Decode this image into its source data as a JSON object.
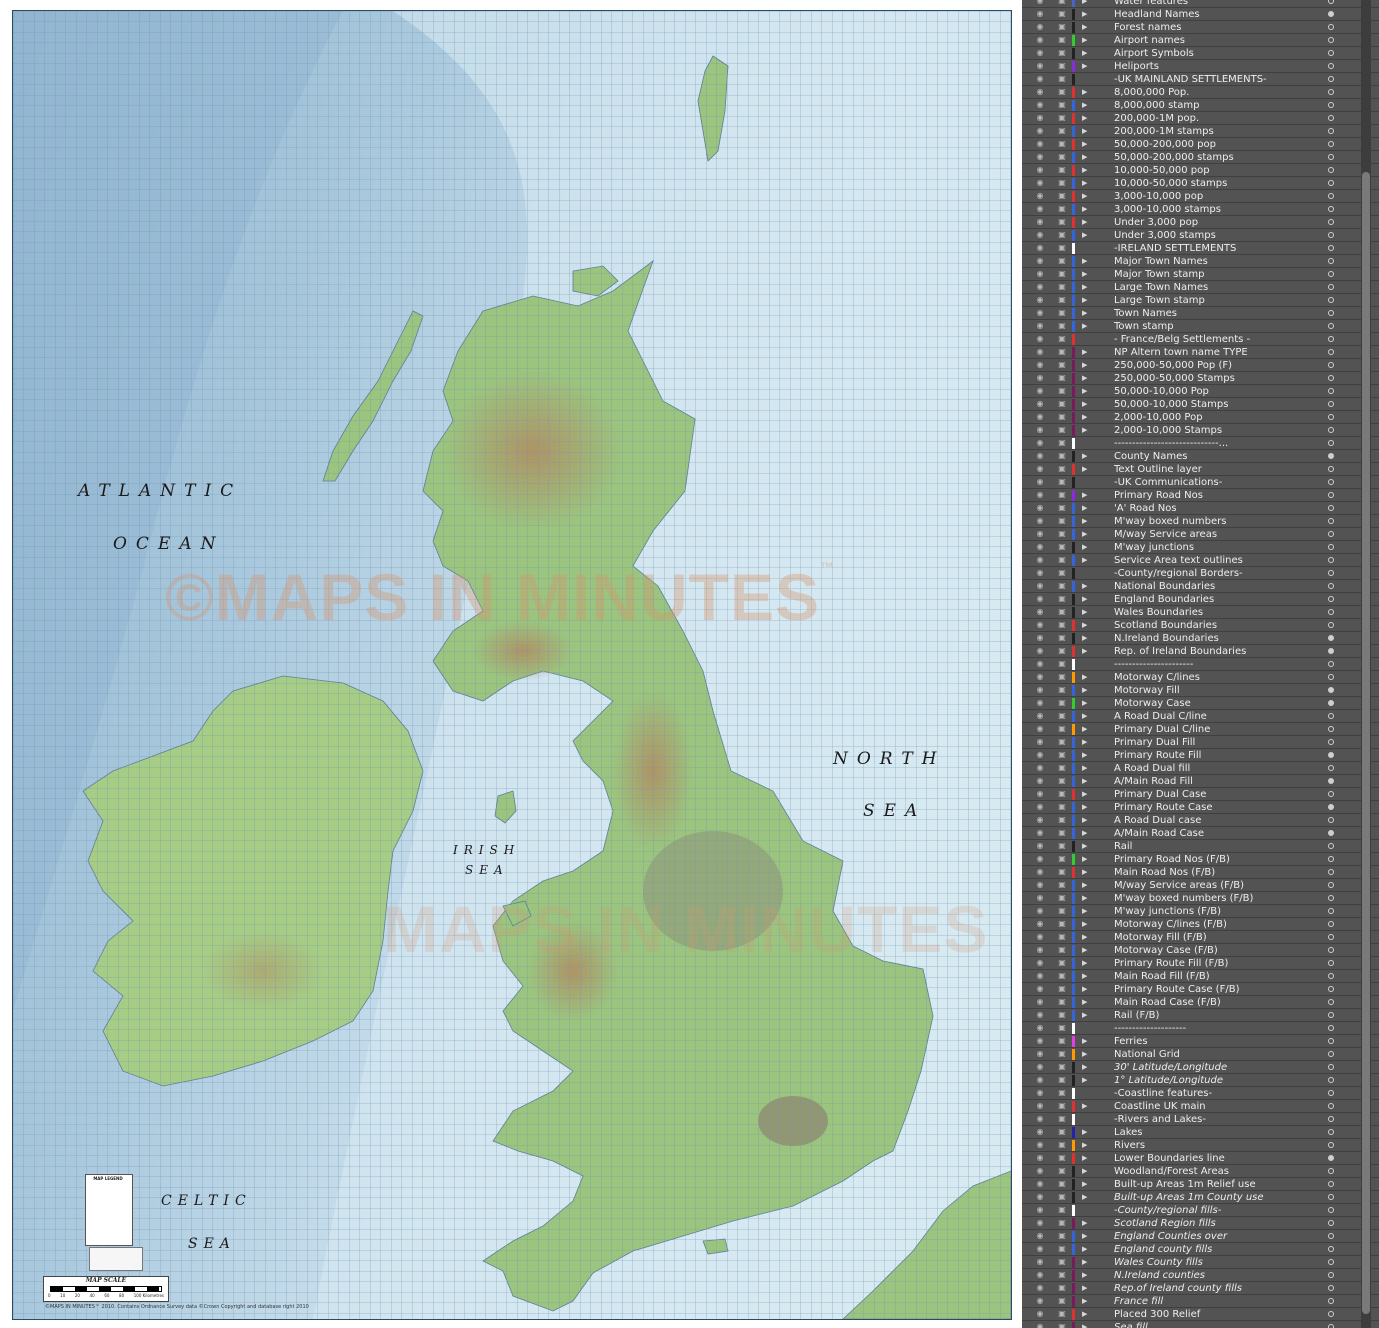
{
  "map": {
    "sea_labels": {
      "atlantic": "ATLANTIC",
      "ocean": "OCEAN",
      "north": "NORTH",
      "sea_north": "SEA",
      "irish": "IRISH",
      "sea_irish": "SEA",
      "celtic": "CELTIC",
      "sea_celtic": "SEA"
    },
    "watermark": "©MAPS IN MINUTES",
    "watermark_tm": "™",
    "watermark_2": "MAPS IN MINUTES",
    "scale_title": "MAP SCALE",
    "scale_ticks": [
      "0",
      "10",
      "20",
      "40",
      "60",
      "80",
      "100 Kilometres"
    ],
    "legend_title": "MAP LEGEND",
    "copyright": "©MAPS IN MINUTES™ 2010. Contains Ordnance Survey data ©Crown Copyright and database right 2010",
    "colors": {
      "sea": "#bcd9ea",
      "land": "#9bc47f",
      "upland": "#b99d74",
      "grid": "#6f93ad"
    }
  },
  "layers": [
    {
      "name": "Water features",
      "color": "#4466cc",
      "expand": true,
      "target": false,
      "italic": false
    },
    {
      "name": "Headland Names",
      "color": "#222222",
      "expand": true,
      "target": true,
      "italic": false
    },
    {
      "name": "Forest names",
      "color": "#222222",
      "expand": true,
      "target": false,
      "italic": false
    },
    {
      "name": "Airport names",
      "color": "#33cc33",
      "expand": true,
      "target": false,
      "italic": false
    },
    {
      "name": "Airport Symbols",
      "color": "#222222",
      "expand": true,
      "target": false,
      "italic": false
    },
    {
      "name": "Heliports",
      "color": "#8a2be2",
      "expand": true,
      "target": false,
      "italic": false
    },
    {
      "name": "-UK MAINLAND SETTLEMENTS-",
      "color": "#222222",
      "expand": false,
      "target": false,
      "italic": false
    },
    {
      "name": "8,000,000 Pop.",
      "color": "#e03030",
      "expand": true,
      "target": false,
      "italic": false
    },
    {
      "name": "8,000,000 stamp",
      "color": "#3366dd",
      "expand": true,
      "target": false,
      "italic": false
    },
    {
      "name": "200,000-1M pop.",
      "color": "#e03030",
      "expand": true,
      "target": false,
      "italic": false
    },
    {
      "name": "200,000-1M stamps",
      "color": "#3366dd",
      "expand": true,
      "target": false,
      "italic": false
    },
    {
      "name": "50,000-200,000 pop",
      "color": "#e03030",
      "expand": true,
      "target": false,
      "italic": false
    },
    {
      "name": "50,000-200,000 stamps",
      "color": "#3366dd",
      "expand": true,
      "target": false,
      "italic": false
    },
    {
      "name": "10,000-50,000 pop",
      "color": "#e03030",
      "expand": true,
      "target": false,
      "italic": false
    },
    {
      "name": "10,000-50,000 stamps",
      "color": "#3366dd",
      "expand": true,
      "target": false,
      "italic": false
    },
    {
      "name": "3,000-10,000 pop",
      "color": "#e03030",
      "expand": true,
      "target": false,
      "italic": false
    },
    {
      "name": "3,000-10,000 stamps",
      "color": "#3366dd",
      "expand": true,
      "target": false,
      "italic": false
    },
    {
      "name": "Under 3,000 pop",
      "color": "#e03030",
      "expand": true,
      "target": false,
      "italic": false
    },
    {
      "name": "Under 3,000 stamps",
      "color": "#3366dd",
      "expand": true,
      "target": false,
      "italic": false
    },
    {
      "name": "-IRELAND SETTLEMENTS",
      "color": "#ffffff",
      "expand": false,
      "target": false,
      "italic": false
    },
    {
      "name": "Major Town Names",
      "color": "#3366dd",
      "expand": true,
      "target": false,
      "italic": false
    },
    {
      "name": "Major Town stamp",
      "color": "#3366dd",
      "expand": true,
      "target": false,
      "italic": false
    },
    {
      "name": "Large Town Names",
      "color": "#3366dd",
      "expand": true,
      "target": false,
      "italic": false
    },
    {
      "name": "Large Town stamp",
      "color": "#3366dd",
      "expand": true,
      "target": false,
      "italic": false
    },
    {
      "name": "Town Names",
      "color": "#3366dd",
      "expand": true,
      "target": false,
      "italic": false
    },
    {
      "name": "Town stamp",
      "color": "#3366dd",
      "expand": true,
      "target": false,
      "italic": false
    },
    {
      "name": "- France/Belg Settlements -",
      "color": "#e03030",
      "expand": false,
      "target": false,
      "italic": false
    },
    {
      "name": "NP Altern town name TYPE",
      "color": "#7a1a5a",
      "expand": true,
      "target": false,
      "italic": false
    },
    {
      "name": "250,000-50,000 Pop (F)",
      "color": "#7a1a5a",
      "expand": true,
      "target": false,
      "italic": false
    },
    {
      "name": "250,000-50,000 Stamps",
      "color": "#7a1a5a",
      "expand": true,
      "target": false,
      "italic": false
    },
    {
      "name": "50,000-10,000 Pop",
      "color": "#7a1a5a",
      "expand": true,
      "target": false,
      "italic": false
    },
    {
      "name": "50,000-10,000 Stamps",
      "color": "#7a1a5a",
      "expand": true,
      "target": false,
      "italic": false
    },
    {
      "name": "2,000-10,000 Pop",
      "color": "#7a1a5a",
      "expand": true,
      "target": false,
      "italic": false
    },
    {
      "name": "2,000-10,000 Stamps",
      "color": "#7a1a5a",
      "expand": true,
      "target": false,
      "italic": false
    },
    {
      "name": "-----------------------------...",
      "color": "#ffffff",
      "expand": false,
      "target": false,
      "italic": false
    },
    {
      "name": "County Names",
      "color": "#222222",
      "expand": true,
      "target": true,
      "italic": false
    },
    {
      "name": "Text Outline layer",
      "color": "#e03030",
      "expand": true,
      "target": false,
      "italic": false
    },
    {
      "name": "-UK Communications-",
      "color": "#222222",
      "expand": false,
      "target": false,
      "italic": false
    },
    {
      "name": "Primary Road Nos",
      "color": "#8a2be2",
      "expand": true,
      "target": false,
      "italic": false
    },
    {
      "name": "'A' Road Nos",
      "color": "#3366dd",
      "expand": true,
      "target": false,
      "italic": false
    },
    {
      "name": "M'way boxed numbers",
      "color": "#3366dd",
      "expand": true,
      "target": false,
      "italic": false
    },
    {
      "name": "M/way Service areas",
      "color": "#3366dd",
      "expand": true,
      "target": false,
      "italic": false
    },
    {
      "name": "M'way junctions",
      "color": "#222222",
      "expand": true,
      "target": false,
      "italic": false
    },
    {
      "name": "Service Area text outlines",
      "color": "#3366dd",
      "expand": true,
      "target": false,
      "italic": false
    },
    {
      "name": "-County/regional Borders-",
      "color": "#222222",
      "expand": false,
      "target": false,
      "italic": false
    },
    {
      "name": "National Boundaries",
      "color": "#3366dd",
      "expand": true,
      "target": false,
      "italic": false
    },
    {
      "name": "England Boundaries",
      "color": "#222222",
      "expand": true,
      "target": false,
      "italic": false
    },
    {
      "name": "Wales Boundaries",
      "color": "#222222",
      "expand": true,
      "target": false,
      "italic": false
    },
    {
      "name": "Scotland Boundaries",
      "color": "#e03030",
      "expand": true,
      "target": false,
      "italic": false
    },
    {
      "name": "N.Ireland Boundaries",
      "color": "#222222",
      "expand": true,
      "target": true,
      "italic": false
    },
    {
      "name": "Rep. of Ireland Boundaries",
      "color": "#e03030",
      "expand": true,
      "target": true,
      "italic": false
    },
    {
      "name": "----------------------",
      "color": "#ffffff",
      "expand": false,
      "target": false,
      "italic": false
    },
    {
      "name": "Motorway C/lines",
      "color": "#ff9900",
      "expand": true,
      "target": false,
      "italic": false
    },
    {
      "name": "Motorway Fill",
      "color": "#3366dd",
      "expand": true,
      "target": true,
      "italic": false
    },
    {
      "name": "Motorway Case",
      "color": "#33cc33",
      "expand": true,
      "target": true,
      "italic": false
    },
    {
      "name": "A Road Dual C/line",
      "color": "#3366dd",
      "expand": true,
      "target": false,
      "italic": false
    },
    {
      "name": "Primary Dual C/line",
      "color": "#ff9900",
      "expand": true,
      "target": false,
      "italic": false
    },
    {
      "name": "Primary Dual Fill",
      "color": "#3366dd",
      "expand": true,
      "target": false,
      "italic": false
    },
    {
      "name": "Primary Route Fill",
      "color": "#3366dd",
      "expand": true,
      "target": true,
      "italic": false
    },
    {
      "name": "A Road Dual fill",
      "color": "#3366dd",
      "expand": true,
      "target": false,
      "italic": false
    },
    {
      "name": "A/Main Road Fill",
      "color": "#3366dd",
      "expand": true,
      "target": true,
      "italic": false
    },
    {
      "name": "Primary Dual Case",
      "color": "#e03030",
      "expand": true,
      "target": false,
      "italic": false
    },
    {
      "name": "Primary Route Case",
      "color": "#3366dd",
      "expand": true,
      "target": true,
      "italic": false
    },
    {
      "name": "A Road Dual case",
      "color": "#3366dd",
      "expand": true,
      "target": false,
      "italic": false
    },
    {
      "name": "A/Main Road Case",
      "color": "#3366dd",
      "expand": true,
      "target": true,
      "italic": false
    },
    {
      "name": "Rail",
      "color": "#222222",
      "expand": true,
      "target": false,
      "italic": false
    },
    {
      "name": "Primary Road Nos (F/B)",
      "color": "#33cc33",
      "expand": true,
      "target": false,
      "italic": false
    },
    {
      "name": "Main Road Nos (F/B)",
      "color": "#e03030",
      "expand": true,
      "target": false,
      "italic": false
    },
    {
      "name": "M/way Service areas (F/B)",
      "color": "#3366dd",
      "expand": true,
      "target": false,
      "italic": false
    },
    {
      "name": "M'way boxed numbers (F/B)",
      "color": "#3366dd",
      "expand": true,
      "target": false,
      "italic": false
    },
    {
      "name": "M'way junctions (F/B)",
      "color": "#3366dd",
      "expand": true,
      "target": false,
      "italic": false
    },
    {
      "name": "Motorway C/lines (F/B)",
      "color": "#3366dd",
      "expand": true,
      "target": false,
      "italic": false
    },
    {
      "name": "Motorway Fill (F/B)",
      "color": "#3366dd",
      "expand": true,
      "target": false,
      "italic": false
    },
    {
      "name": "Motorway Case (F/B)",
      "color": "#3366dd",
      "expand": true,
      "target": false,
      "italic": false
    },
    {
      "name": "Primary Route Fill (F/B)",
      "color": "#3366dd",
      "expand": true,
      "target": false,
      "italic": false
    },
    {
      "name": "Main Road Fill (F/B)",
      "color": "#3366dd",
      "expand": true,
      "target": false,
      "italic": false
    },
    {
      "name": "Primary Route Case (F/B)",
      "color": "#3366dd",
      "expand": true,
      "target": false,
      "italic": false
    },
    {
      "name": "Main Road Case (F/B)",
      "color": "#3366dd",
      "expand": true,
      "target": false,
      "italic": false
    },
    {
      "name": "Rail (F/B)",
      "color": "#3366dd",
      "expand": true,
      "target": false,
      "italic": false
    },
    {
      "name": "--------------------",
      "color": "#ffffff",
      "expand": false,
      "target": false,
      "italic": false
    },
    {
      "name": "Ferries",
      "color": "#e040e0",
      "expand": true,
      "target": false,
      "italic": false
    },
    {
      "name": "National Grid",
      "color": "#ff9900",
      "expand": true,
      "target": false,
      "italic": false
    },
    {
      "name": "30' Latitude/Longitude",
      "color": "#222222",
      "expand": true,
      "target": false,
      "italic": true
    },
    {
      "name": "1° Latitude/Longitude",
      "color": "#222222",
      "expand": true,
      "target": false,
      "italic": true
    },
    {
      "name": "-Coastline features-",
      "color": "#ffffff",
      "expand": false,
      "target": false,
      "italic": false
    },
    {
      "name": "Coastline UK main",
      "color": "#e03030",
      "expand": true,
      "target": false,
      "italic": false
    },
    {
      "name": "-Rivers and Lakes-",
      "color": "#ffffff",
      "expand": false,
      "target": false,
      "italic": false
    },
    {
      "name": "Lakes",
      "color": "#2222aa",
      "expand": true,
      "target": false,
      "italic": false
    },
    {
      "name": "Rivers",
      "color": "#ff9900",
      "expand": true,
      "target": false,
      "italic": false
    },
    {
      "name": "Lower Boundaries line",
      "color": "#e03030",
      "expand": true,
      "target": true,
      "italic": false
    },
    {
      "name": "Woodland/Forest Areas",
      "color": "#222222",
      "expand": true,
      "target": false,
      "italic": false
    },
    {
      "name": "Built-up Areas 1m Relief use",
      "color": "#222222",
      "expand": true,
      "target": false,
      "italic": false
    },
    {
      "name": "Built-up Areas 1m County use",
      "color": "#222222",
      "expand": true,
      "target": false,
      "italic": true
    },
    {
      "name": "-County/regional fills-",
      "color": "#ffffff",
      "expand": false,
      "target": false,
      "italic": true
    },
    {
      "name": "Scotland Region fills",
      "color": "#7a1a5a",
      "expand": true,
      "target": false,
      "italic": true
    },
    {
      "name": "England Counties over",
      "color": "#3366dd",
      "expand": true,
      "target": false,
      "italic": true
    },
    {
      "name": "England county fills",
      "color": "#3366dd",
      "expand": true,
      "target": false,
      "italic": true
    },
    {
      "name": "Wales County fills",
      "color": "#7a1a5a",
      "expand": true,
      "target": false,
      "italic": true
    },
    {
      "name": "N.Ireland counties",
      "color": "#7a1a5a",
      "expand": true,
      "target": false,
      "italic": true
    },
    {
      "name": "Rep.of Ireland county fills",
      "color": "#7a1a5a",
      "expand": true,
      "target": false,
      "italic": true
    },
    {
      "name": "France fill",
      "color": "#7a1a5a",
      "expand": true,
      "target": false,
      "italic": true
    },
    {
      "name": "Placed 300 Relief",
      "color": "#e03030",
      "expand": true,
      "target": false,
      "italic": false
    },
    {
      "name": "Sea fill",
      "color": "#7a1a5a",
      "expand": true,
      "target": false,
      "italic": true
    }
  ]
}
